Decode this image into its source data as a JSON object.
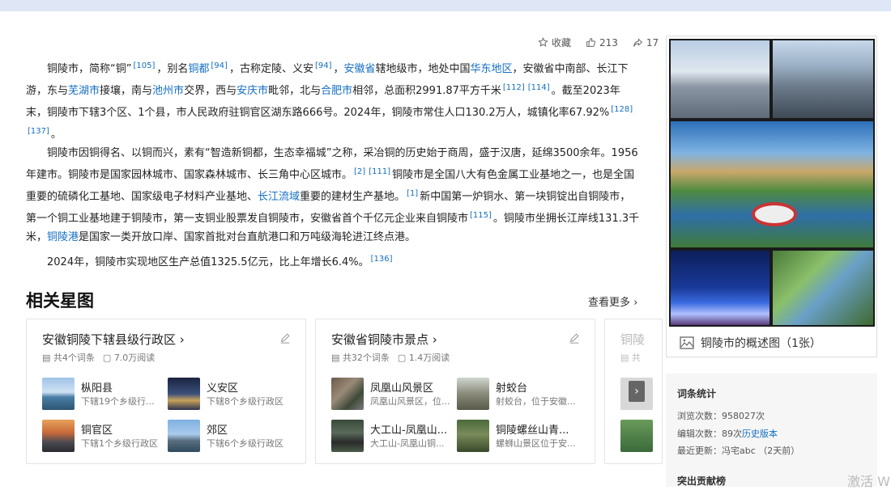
{
  "actions": {
    "collect": "收藏",
    "likes": "213",
    "shares": "17"
  },
  "para1": {
    "t1": "铜陵市，简称“铜”",
    "s1": "[105]",
    "t2": "，别名",
    "l1": "铜都",
    "s2": "[94]",
    "t3": "，古称定陵、义安",
    "s3": "[94]",
    "t4": "，",
    "l2": "安徽省",
    "t5": "辖地级市，地处中国",
    "l3": "华东地区",
    "t6": "，安徽省中南部、长江下游，东与",
    "l4": "芜湖市",
    "t7": "接壤，南与",
    "l5": "池州市",
    "t8": "交界，西与",
    "l6": "安庆市",
    "t9": "毗邻，北与",
    "l7": "合肥市",
    "t10": "相邻，总面积2991.87平方千米",
    "s4": "[112]",
    "s5": "[114]",
    "t11": "。截至2023年末，铜陵市下辖3个区、1个县，市人民政府驻铜官区湖东路666号。2024年，铜陵市常住人口130.2万人，城镇化率67.92%",
    "s6": "[128]",
    "s7": "[137]",
    "t12": "。"
  },
  "para2": {
    "t1": "铜陵市因铜得名、以铜而兴，素有“智造新铜都，生态幸福城”之称，采冶铜的历史始于商周，盛于汉唐，延绵3500余年。1956年建市。铜陵市是国家园林城市、国家森林城市、长三角中心区城市。",
    "s1": "[2]",
    "s2": "[111]",
    "t2": "铜陵市是全国八大有色金属工业基地之一，也是全国重要的硫磷化工基地、国家级电子材料产业基地、",
    "l1": "长江流域",
    "t3": "重要的建材生产基地。",
    "s3": "[1]",
    "t4": "新中国第一炉铜水、第一块铜锭出自铜陵市，第一个铜工业基地建于铜陵市，第一支铜业股票发自铜陵市，安徽省首个千亿元企业来自铜陵市",
    "s4": "[115]",
    "t5": "。铜陵市坐拥长江岸线131.3千米，",
    "l2": "铜陵港",
    "t6": "是国家一类开放口岸、国家首批对台直航港口和万吨级海轮进江终点港。"
  },
  "para3": {
    "t1": "2024年，铜陵市实现地区生产总值1325.5亿元，比上年增长6.4%。",
    "s1": "[136]"
  },
  "section": {
    "title": "相关星图",
    "see_more": "查看更多"
  },
  "cards": [
    {
      "title": "安徽铜陵下辖县级行政区",
      "count": "共4个词条",
      "views": "7.0万阅读",
      "items": [
        {
          "name": "枞阳县",
          "desc": "下辖19个乡级行..."
        },
        {
          "name": "义安区",
          "desc": "下辖8个乡级行政区"
        },
        {
          "name": "铜官区",
          "desc": "下辖1个乡级行政区"
        },
        {
          "name": "郊区",
          "desc": "下辖6个乡级行政区"
        }
      ]
    },
    {
      "title": "安徽省铜陵市景点",
      "count": "共32个词条",
      "views": "1.4万阅读",
      "items": [
        {
          "name": "凤凰山风景区",
          "desc": "凤凰山风景区，位..."
        },
        {
          "name": "射蛟台",
          "desc": "射蛟台，位于安徽..."
        },
        {
          "name": "大工山-凤凰山...",
          "desc": "大工山-凤凰山铜..."
        },
        {
          "name": "铜陵螺丝山青...",
          "desc": "螺蛳山景区位于安..."
        }
      ]
    },
    {
      "title": "铜陵",
      "count": "共",
      "views": ""
    }
  ],
  "album": {
    "caption": "铜陵市的概述图（1张）"
  },
  "stats": {
    "title": "词条统计",
    "views_label": "浏览次数：",
    "views": "958027次",
    "edits_label": "编辑次数：",
    "edits": "89次",
    "history": "历史版本",
    "updated_label": "最近更新：",
    "updater": "冯宅abc",
    "updated_time": "（2天前）",
    "contrib_title": "突出贡献榜"
  },
  "watermark": "激活 W",
  "colors": {
    "link": "#136ec2",
    "text": "#222222"
  }
}
